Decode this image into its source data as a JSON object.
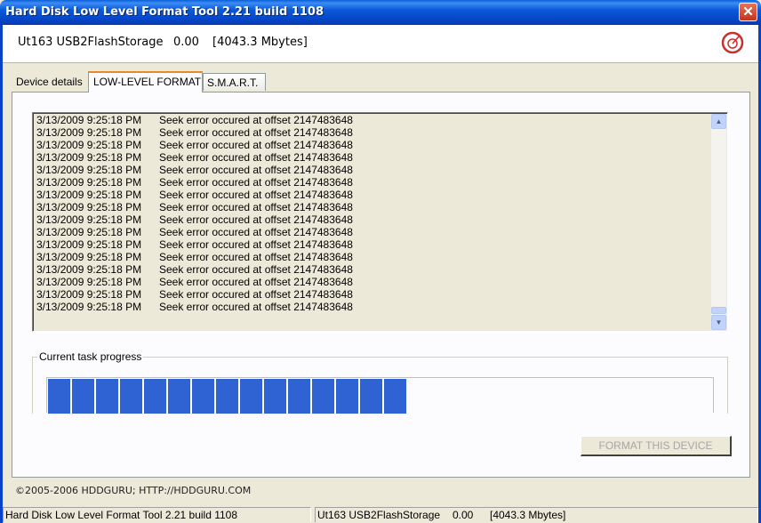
{
  "window": {
    "title": "Hard Disk Low Level Format Tool 2.21 build 1108",
    "close_glyph": "✕"
  },
  "device": {
    "name": "Ut163 USB2FlashStorage",
    "value": "0.00",
    "size": "[4043.3 Mbytes]",
    "logo_icon": "hddguru-logo-icon"
  },
  "tabs": {
    "details": "Device details",
    "low_level_format": "LOW-LEVEL FORMAT",
    "smart": "S.M.A.R.T."
  },
  "log": {
    "lines": [
      {
        "time": "3/13/2009 9:25:18 PM",
        "message": "Seek error occured at offset 2147483648"
      },
      {
        "time": "3/13/2009 9:25:18 PM",
        "message": "Seek error occured at offset 2147483648"
      },
      {
        "time": "3/13/2009 9:25:18 PM",
        "message": "Seek error occured at offset 2147483648"
      },
      {
        "time": "3/13/2009 9:25:18 PM",
        "message": "Seek error occured at offset 2147483648"
      },
      {
        "time": "3/13/2009 9:25:18 PM",
        "message": "Seek error occured at offset 2147483648"
      },
      {
        "time": "3/13/2009 9:25:18 PM",
        "message": "Seek error occured at offset 2147483648"
      },
      {
        "time": "3/13/2009 9:25:18 PM",
        "message": "Seek error occured at offset 2147483648"
      },
      {
        "time": "3/13/2009 9:25:18 PM",
        "message": "Seek error occured at offset 2147483648"
      },
      {
        "time": "3/13/2009 9:25:18 PM",
        "message": "Seek error occured at offset 2147483648"
      },
      {
        "time": "3/13/2009 9:25:18 PM",
        "message": "Seek error occured at offset 2147483648"
      },
      {
        "time": "3/13/2009 9:25:18 PM",
        "message": "Seek error occured at offset 2147483648"
      },
      {
        "time": "3/13/2009 9:25:18 PM",
        "message": "Seek error occured at offset 2147483648"
      },
      {
        "time": "3/13/2009 9:25:18 PM",
        "message": "Seek error occured at offset 2147483648"
      },
      {
        "time": "3/13/2009 9:25:18 PM",
        "message": "Seek error occured at offset 2147483648"
      },
      {
        "time": "3/13/2009 9:25:18 PM",
        "message": "Seek error occured at offset 2147483648"
      },
      {
        "time": "3/13/2009 9:25:18 PM",
        "message": "Seek error occured at offset 2147483648"
      }
    ]
  },
  "progress": {
    "label": "Current task progress",
    "fraction": 0.54,
    "color": "#2f63d3"
  },
  "format_button": "FORMAT THIS DEVICE",
  "footer": {
    "copyright": "©2005-2006 HDDGURU;  HTTP://HDDGURU.COM"
  },
  "statusbar": {
    "app": "Hard Disk Low Level Format Tool 2.21 build 1108",
    "device_name": "Ut163 USB2FlashStorage",
    "device_value": "0.00",
    "device_size": "[4043.3 Mbytes]"
  },
  "colors": {
    "titlebar": "#0a59d8",
    "face": "#ece9d8",
    "active_tab_accent": "#e68b2c"
  }
}
